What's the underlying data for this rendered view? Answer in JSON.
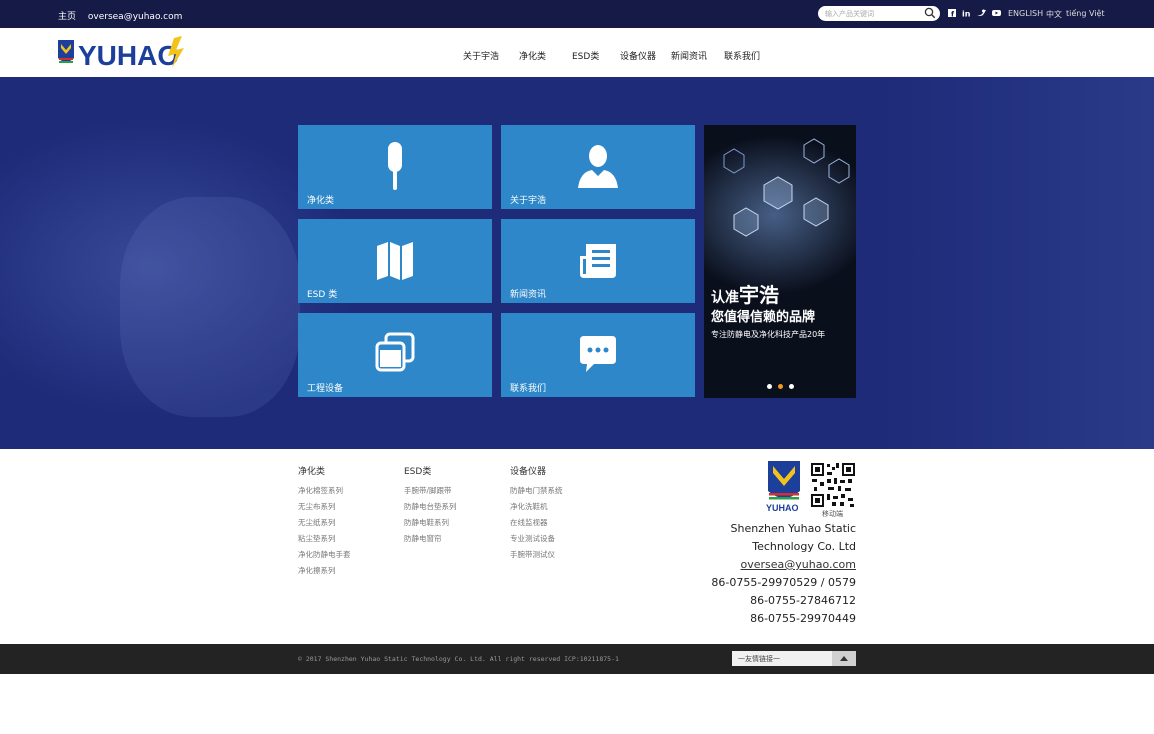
{
  "topbar": {
    "home": "主页",
    "email": "oversea@yuhao.com",
    "search_placeholder": "输入产品关键词",
    "langs": [
      "ENGLISH",
      "中文",
      "tiếng Việt"
    ]
  },
  "logo_text": "YUHAO",
  "nav": [
    "关于宇浩",
    "净化类",
    "ESD类",
    "设备仪器",
    "新闻资讯",
    "联系我们"
  ],
  "tiles": [
    {
      "label": "净化类",
      "icon": "swab-icon"
    },
    {
      "label": "关于宇浩",
      "icon": "person-icon"
    },
    {
      "label": "ESD 类",
      "icon": "map-icon"
    },
    {
      "label": "新闻资讯",
      "icon": "newspaper-icon"
    },
    {
      "label": "工程设备",
      "icon": "windows-icon"
    },
    {
      "label": "联系我们",
      "icon": "chat-icon"
    }
  ],
  "banner": {
    "line1_small": "认准",
    "line1_big": "宇浩",
    "line2": "您值得信赖的品牌",
    "line3": "专注防静电及净化科技产品20年"
  },
  "footer": {
    "cols": [
      {
        "title": "净化类",
        "items": [
          "净化棉签系列",
          "无尘布系列",
          "无尘纸系列",
          "粘尘垫系列",
          "净化防静电手套",
          "净化擦系列"
        ]
      },
      {
        "title": "ESD类",
        "items": [
          "手腕带/脚跟带",
          "防静电台垫系列",
          "防静电鞋系列",
          "防静电窗帘"
        ]
      },
      {
        "title": "设备仪器",
        "items": [
          "防静电门禁系统",
          "净化洗鞋机",
          "在线监视器",
          "专业测试设备",
          "手腕带测试仪"
        ]
      }
    ],
    "qr_caption": "移动端",
    "company_line1": "Shenzhen Yuhao Static",
    "company_line2": "Technology Co. Ltd",
    "email": "oversea@yuhao.com",
    "phones": [
      "86-0755-29970529 / 0579",
      "86-0755-27846712",
      "86-0755-29970449"
    ]
  },
  "bottombar": {
    "copyright": "© 2017 Shenzhen Yuhao Static Technology Co. Ltd. All right reserved ICP:10211875-1",
    "friend_links": "一友情链接一"
  },
  "colors": {
    "topbar": "#151a47",
    "hero": "#1d2b79",
    "tile": "#2e87c8",
    "accent_orange": "#f29a1f",
    "bottombar": "#232323"
  }
}
